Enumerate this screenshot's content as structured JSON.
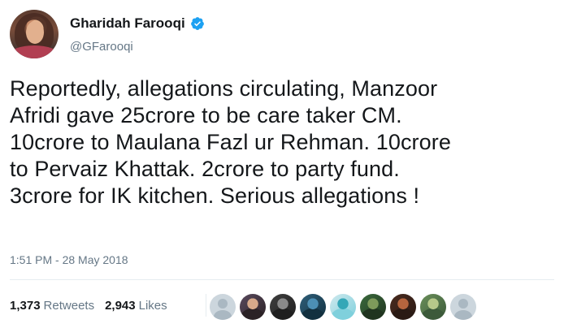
{
  "author": {
    "display_name": "Gharidah Farooqi",
    "handle": "@GFarooqi",
    "verified": true
  },
  "tweet": {
    "lines": [
      "Reportedly, allegations circulating, Manzoor",
      "Afridi gave 25crore to be care taker CM.",
      "10crore to Maulana Fazl ur Rehman. 10crore",
      "to Pervaiz Khattak. 2crore to party fund.",
      "3crore for IK kitchen. Serious allegations !"
    ],
    "timestamp": "1:51 PM - 28 May 2018"
  },
  "stats": {
    "retweets_count": "1,373",
    "retweets_label": "Retweets",
    "likes_count": "2,943",
    "likes_label": "Likes"
  },
  "likers": [
    {
      "kind": "default",
      "color": "#ccd6dd"
    },
    {
      "kind": "photo",
      "colors": [
        "#5a4a5e",
        "#d7a98b",
        "#2b2226"
      ]
    },
    {
      "kind": "photo",
      "colors": [
        "#3f3f3f",
        "#8a8a8a",
        "#1f1f1f"
      ]
    },
    {
      "kind": "photo",
      "colors": [
        "#2f5f7a",
        "#4c8fb4",
        "#12303f"
      ]
    },
    {
      "kind": "photo",
      "colors": [
        "#cfe9ee",
        "#35a7b7",
        "#7fd0dc"
      ]
    },
    {
      "kind": "photo",
      "colors": [
        "#3b6b3d",
        "#7e9a5b",
        "#20341f"
      ]
    },
    {
      "kind": "photo",
      "colors": [
        "#4a2b1f",
        "#b6653e",
        "#2a1a14"
      ]
    },
    {
      "kind": "photo",
      "colors": [
        "#6a8f5a",
        "#b7c98a",
        "#3c5a3a"
      ]
    },
    {
      "kind": "default",
      "color": "#ccd6dd"
    }
  ],
  "colors": {
    "text": "#14171a",
    "secondary": "#657786",
    "verified": "#1da1f2",
    "divider": "#e6ecf0"
  }
}
